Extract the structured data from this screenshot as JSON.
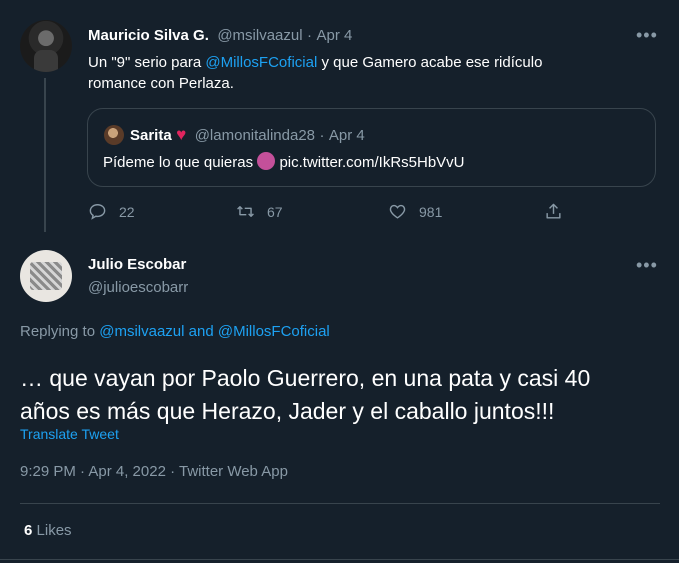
{
  "parent_tweet": {
    "display_name": "Mauricio Silva G.",
    "handle": "@msilvaazul",
    "dot": "·",
    "date": "Apr 4",
    "text_pre": "Un \"9\" serio para ",
    "mention": "@MillosFCoficial",
    "text_post": " y que Gamero acabe ese ridículo",
    "text_line2": "romance con Perlaza.",
    "quote": {
      "display_name": "Sarita",
      "heart": "♥",
      "handle": "@lamonitalinda28",
      "dot": "·",
      "date": "Apr 4",
      "text": "Pídeme lo que quieras",
      "emoji": "😈",
      "link": "pic.twitter.com/IkRs5HbVvU"
    },
    "actions": {
      "replies": "22",
      "retweets": "67",
      "likes": "981"
    }
  },
  "main_tweet": {
    "display_name": "Julio Escobar",
    "handle": "@julioescobarr",
    "replying_prefix": "Replying to ",
    "reply_mention_1": "@msilvaazul",
    "reply_and": " and ",
    "reply_mention_2": "@MillosFCoficial",
    "text_line1": "… que vayan por Paolo Guerrero, en una pata y casi 40",
    "text_line2": "años es más que Herazo, Jader y el caballo juntos!!!",
    "translate": "Translate Tweet",
    "meta": "9:29 PM · Apr 4, 2022 · Twitter Web App",
    "likes_count": "6",
    "likes_label": "Likes"
  },
  "icons": {
    "more": "more-horizontal-icon",
    "reply": "reply-icon",
    "retweet": "retweet-icon",
    "like": "heart-icon",
    "share": "share-icon"
  },
  "colors": {
    "background": "#15202b",
    "border": "#38444d",
    "muted": "#8899a6",
    "link": "#1da1f2",
    "heart": "#e0245e"
  }
}
